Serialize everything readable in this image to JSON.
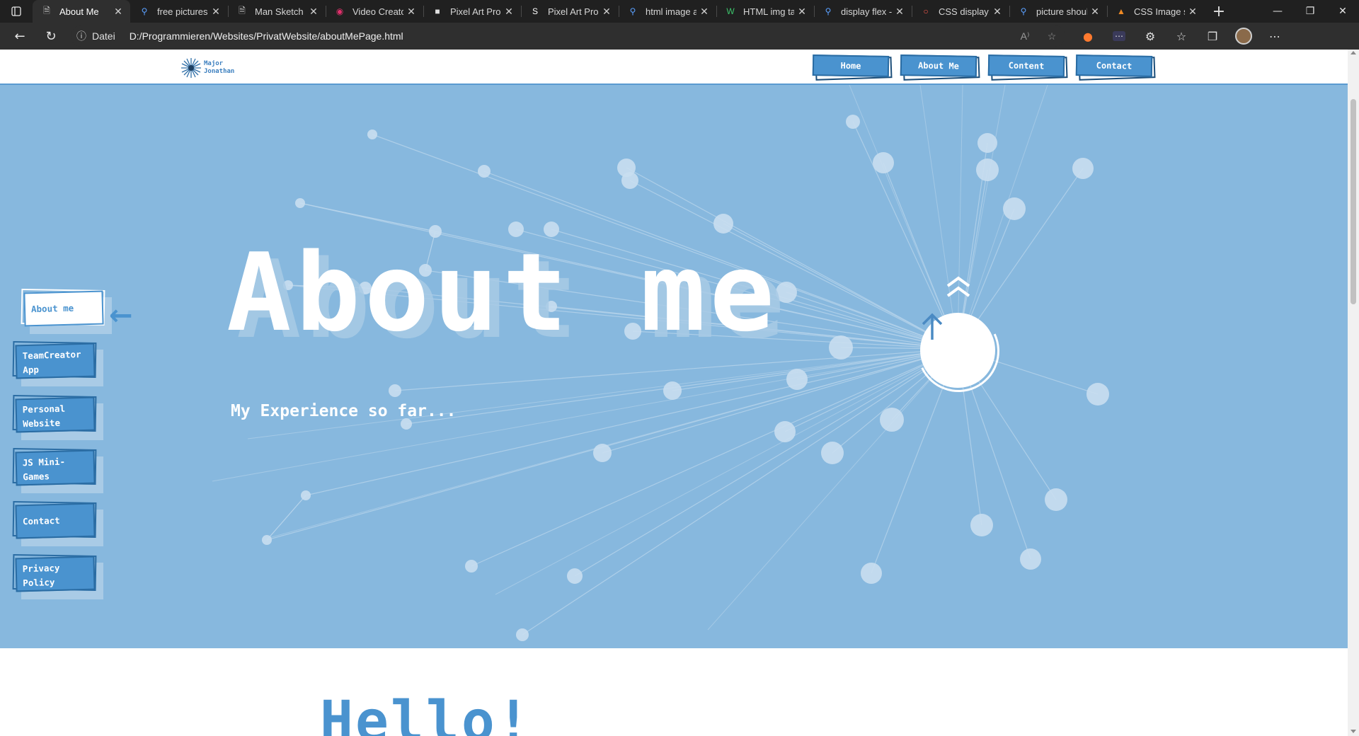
{
  "browser": {
    "tabs": [
      {
        "title": "About Me",
        "icon": "page-icon",
        "active": true
      },
      {
        "title": "free pictures",
        "icon": "search-icon"
      },
      {
        "title": "Man Sketch B",
        "icon": "page-icon"
      },
      {
        "title": "Video Creato",
        "icon": "instagram-icon"
      },
      {
        "title": "Pixel Art Prog",
        "icon": "pixel-icon"
      },
      {
        "title": "Pixel Art Prog",
        "icon": "s-icon"
      },
      {
        "title": "html image a",
        "icon": "search-icon"
      },
      {
        "title": "HTML img ta",
        "icon": "w-icon"
      },
      {
        "title": "display flex -",
        "icon": "search-icon"
      },
      {
        "title": "CSS display:fl",
        "icon": "css-icon"
      },
      {
        "title": "picture shoul",
        "icon": "search-icon"
      },
      {
        "title": "CSS Image si",
        "icon": "html-icon"
      }
    ],
    "address": {
      "label": "Datei",
      "url": "D:/Programmieren/Websites/PrivatWebsite/aboutMePage.html"
    }
  },
  "site": {
    "logo": {
      "line1": "Major",
      "line2": "Jonathan"
    },
    "topnav": [
      "Home",
      "About Me",
      "Content",
      "Contact"
    ],
    "side_menu": [
      {
        "label": "About me",
        "active": true
      },
      {
        "label": "TeamCreator App"
      },
      {
        "label": "Personal Website"
      },
      {
        "label": "JS Mini-Games"
      },
      {
        "label": "Contact"
      },
      {
        "label": "Privacy Policy"
      }
    ],
    "hero": {
      "title": "About me",
      "subtitle": "My Experience so far...",
      "accent_color": "#4a93cf",
      "bg_color": "#87b8de"
    },
    "section": {
      "heading": "Hello!"
    }
  }
}
